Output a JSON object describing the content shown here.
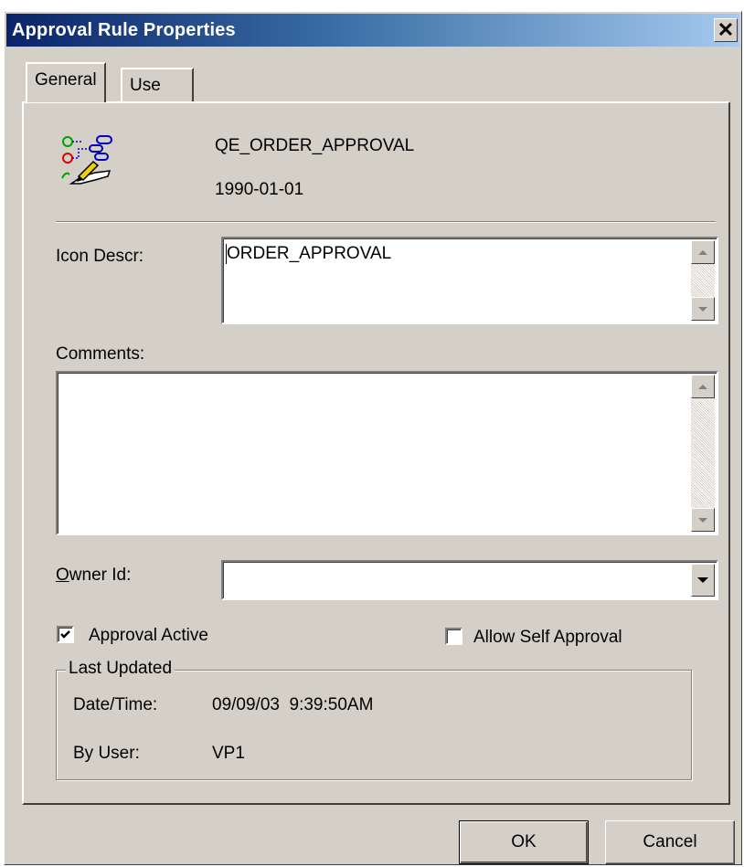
{
  "window": {
    "title": "Approval Rule Properties",
    "close_glyph": "✕"
  },
  "tabs": [
    {
      "label": "General",
      "active": true
    },
    {
      "label": "Use",
      "active": false
    }
  ],
  "header": {
    "icon": "approval-rule-icon",
    "rule_name": "QE_ORDER_APPROVAL",
    "effective_date": "1990-01-01"
  },
  "fields": {
    "icon_descr": {
      "label": "Icon Descr:",
      "value": "ORDER_APPROVAL"
    },
    "comments": {
      "label": "Comments:",
      "value": ""
    },
    "owner_id": {
      "label_accel": "O",
      "label_rest": "wner Id:",
      "value": ""
    }
  },
  "checkboxes": {
    "approval_active": {
      "label": "Approval Active",
      "checked": true
    },
    "allow_self_approval": {
      "label": "Allow Self Approval",
      "checked": false
    }
  },
  "last_updated": {
    "legend": "Last Updated",
    "datetime_label": "Date/Time:",
    "datetime_value": "09/09/03  9:39:50AM",
    "by_user_label": "By User:",
    "by_user_value": "VP1"
  },
  "buttons": {
    "ok": "OK",
    "cancel": "Cancel"
  }
}
